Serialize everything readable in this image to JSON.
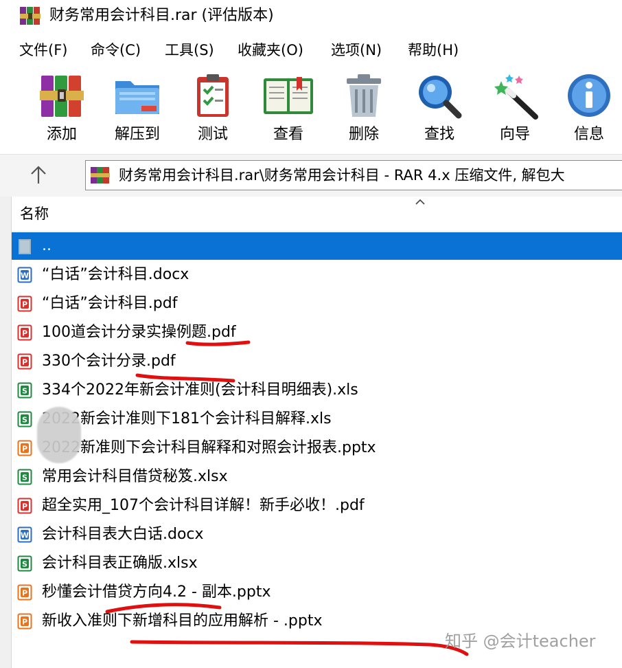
{
  "window": {
    "title": "财务常用会计科目.rar (评估版本)"
  },
  "menu": [
    "文件(F)",
    "命令(C)",
    "工具(S)",
    "收藏夹(O)",
    "选项(N)",
    "帮助(H)"
  ],
  "toolbar": [
    {
      "label": "添加",
      "icon": "add-books-icon"
    },
    {
      "label": "解压到",
      "icon": "extract-folder-icon"
    },
    {
      "label": "测试",
      "icon": "test-clipboard-icon"
    },
    {
      "label": "查看",
      "icon": "view-book-icon"
    },
    {
      "label": "删除",
      "icon": "delete-trash-icon"
    },
    {
      "label": "查找",
      "icon": "find-magnifier-icon"
    },
    {
      "label": "向导",
      "icon": "wizard-wand-icon"
    },
    {
      "label": "信息",
      "icon": "info-icon"
    }
  ],
  "address": {
    "text": "财务常用会计科目.rar\\财务常用会计科目 - RAR 4.x 压缩文件, 解包大"
  },
  "list": {
    "column_name": "名称",
    "rows": [
      {
        "name": "..",
        "type": "folder",
        "selected": true
      },
      {
        "name": "“白话”会计科目.docx",
        "type": "docx"
      },
      {
        "name": "“白话”会计科目.pdf",
        "type": "pdf"
      },
      {
        "name": "100道会计分录实操例题.pdf",
        "type": "pdf"
      },
      {
        "name": "330个会计分录.pdf",
        "type": "pdf"
      },
      {
        "name": "334个2022年新会计准则(会计科目明细表).xls",
        "type": "xls"
      },
      {
        "name": "2022新会计准则下181个会计科目解释.xls",
        "type": "xls"
      },
      {
        "name": "2022新准则下会计科目解释和对照会计报表.pptx",
        "type": "pptx"
      },
      {
        "name": "常用会计科目借贷秘笈.xlsx",
        "type": "xlsx"
      },
      {
        "name": "超全实用_107个会计科目详解！新手必收！.pdf",
        "type": "pdf"
      },
      {
        "name": "会计科目表大白话.docx",
        "type": "docx"
      },
      {
        "name": "会计科目表正确版.xlsx",
        "type": "xlsx"
      },
      {
        "name": "秒懂会计借贷方向4.2 - 副本.pptx",
        "type": "pptx"
      },
      {
        "name": "新收入准则下新增科目的应用解析 - .pptx",
        "type": "pptx"
      }
    ]
  },
  "watermark": "知乎 @会计teacher",
  "colors": {
    "selection": "#0a72d4",
    "highlight_mark": "#e01010",
    "pdf": "#d9302c",
    "word": "#2b6cc4",
    "excel": "#1e8a3f",
    "ppt": "#e8731d"
  }
}
